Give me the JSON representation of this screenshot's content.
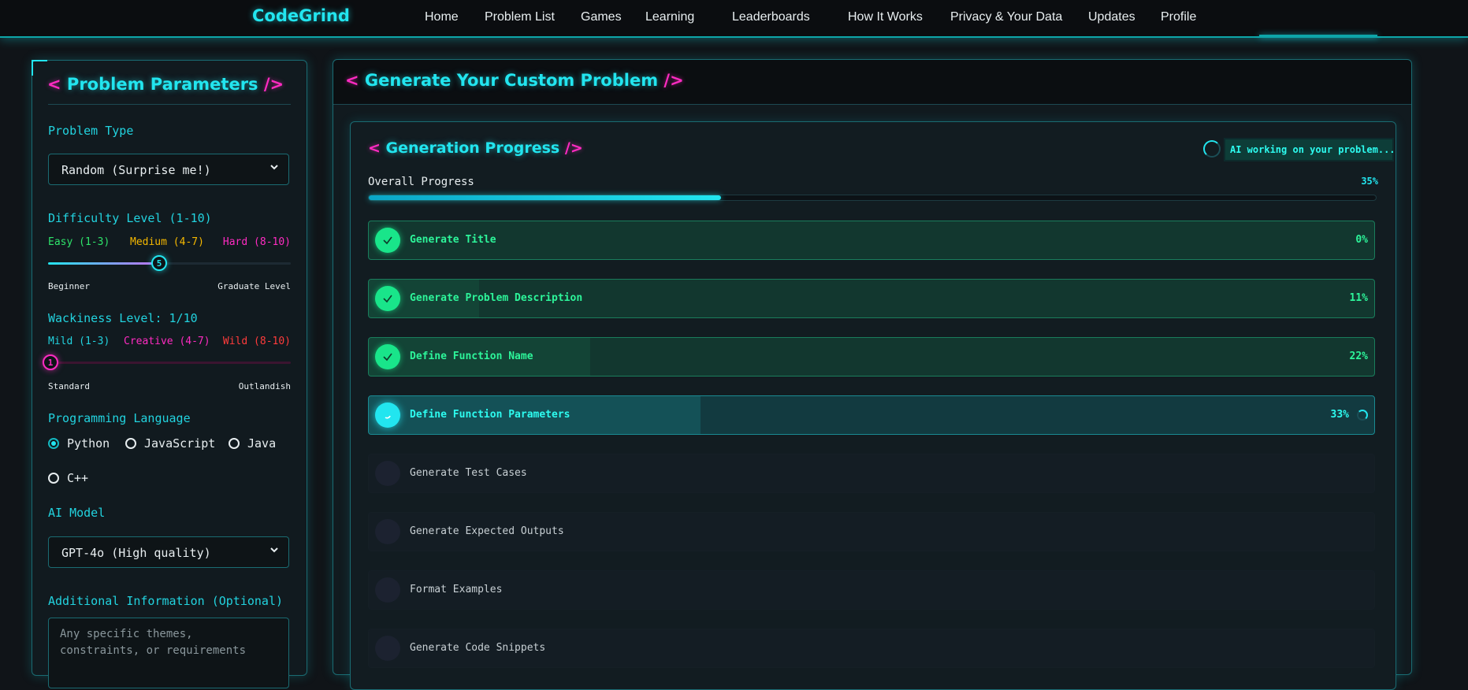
{
  "nav": {
    "brand": "CodeGrind",
    "links": [
      "Home",
      "Problem List",
      "Games",
      "Learning",
      "Leaderboards",
      "How It Works",
      "Privacy & Your Data",
      "Updates",
      "Profile"
    ]
  },
  "params": {
    "title_open": "<",
    "title": "Problem Parameters",
    "title_close": "/>",
    "problem_type_label": "Problem Type",
    "problem_type_value": "Random (Surprise me!)",
    "difficulty_label": "Difficulty Level (1-10)",
    "difficulty_levels": [
      "Easy (1-3)",
      "Medium (4-7)",
      "Hard (8-10)"
    ],
    "difficulty_value": "5",
    "difficulty_min_label": "Beginner",
    "difficulty_max_label": "Graduate Level",
    "wackiness_label": "Wackiness Level: 1/10",
    "wackiness_levels": [
      "Mild (1-3)",
      "Creative (4-7)",
      "Wild (8-10)"
    ],
    "wackiness_value": "1",
    "wackiness_min_label": "Standard",
    "wackiness_max_label": "Outlandish",
    "language_label": "Programming Language",
    "languages": [
      "Python",
      "JavaScript",
      "Java",
      "C++"
    ],
    "selected_language": "Python",
    "model_label": "AI Model",
    "model_value": "GPT-4o (High quality)",
    "additional_label": "Additional Information (Optional)",
    "additional_placeholder": "Any specific themes, constraints, or requirements"
  },
  "generate": {
    "title_open": "<",
    "title": "Generate Your Custom Problem",
    "title_close": "/>"
  },
  "progress": {
    "title_open": "<",
    "title": "Generation Progress",
    "title_close": "/>",
    "status": "AI working on your problem...",
    "overall_label": "Overall Progress",
    "overall_pct": "35%",
    "overall_value": 0.35,
    "steps": [
      {
        "name": "Generate Title",
        "pct": "0%",
        "state": "done",
        "fill": 0.0
      },
      {
        "name": "Generate Problem Description",
        "pct": "11%",
        "state": "done",
        "fill": 0.11
      },
      {
        "name": "Define Function Name",
        "pct": "22%",
        "state": "done",
        "fill": 0.22
      },
      {
        "name": "Define Function Parameters",
        "pct": "33%",
        "state": "active",
        "fill": 0.33
      },
      {
        "name": "Generate Test Cases",
        "pct": "",
        "state": "pending",
        "fill": 0
      },
      {
        "name": "Generate Expected Outputs",
        "pct": "",
        "state": "pending",
        "fill": 0
      },
      {
        "name": "Format Examples",
        "pct": "",
        "state": "pending",
        "fill": 0
      },
      {
        "name": "Generate Code Snippets",
        "pct": "",
        "state": "pending",
        "fill": 0
      }
    ]
  },
  "colors": {
    "accent": "#22e5ef",
    "bracket": "#ff2bc2",
    "done": "#19e58a",
    "easy": "#2ee36a",
    "medium": "#f5b800",
    "hard": "#ff2bc2",
    "wild": "#ff3b3b"
  }
}
